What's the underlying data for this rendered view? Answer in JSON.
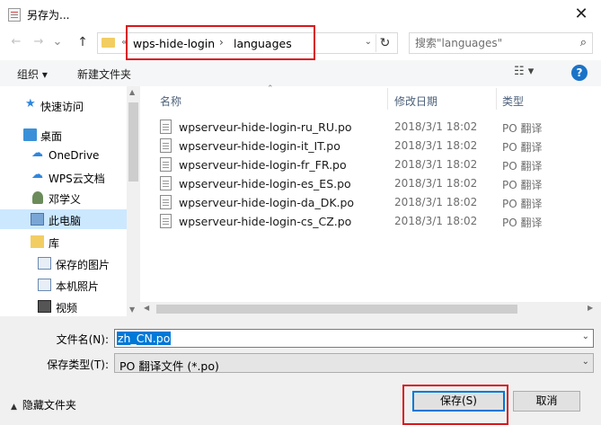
{
  "window": {
    "title": "另存为...",
    "close_glyph": "✕"
  },
  "nav": {
    "back_glyph": "←",
    "forward_glyph": "→",
    "history_glyph": "⌄",
    "up_glyph": "↑",
    "overflow_glyph": "«",
    "breadcrumb": [
      "wps-hide-login",
      "languages"
    ],
    "separator_glyph": "›",
    "dropdown_glyph": "⌄",
    "refresh_glyph": "↻",
    "search_placeholder": "搜索\"languages\"",
    "search_icon": "search-icon"
  },
  "toolbar": {
    "organize": "组织 ▾",
    "new_folder": "新建文件夹",
    "view_glyph": "☷ ▾",
    "help": "?"
  },
  "sidebar": {
    "items": [
      {
        "label": "快速访问",
        "icon": "star-icon",
        "glyph": "★"
      },
      {
        "label": "桌面",
        "icon": "desktop-icon",
        "glyph": ""
      },
      {
        "label": "OneDrive",
        "icon": "cloud-icon",
        "glyph": "☁"
      },
      {
        "label": "WPS云文档",
        "icon": "wps-cloud-icon",
        "glyph": "☁"
      },
      {
        "label": "邓学义",
        "icon": "user-icon",
        "glyph": ""
      },
      {
        "label": "此电脑",
        "icon": "computer-icon",
        "glyph": ""
      },
      {
        "label": "库",
        "icon": "library-icon",
        "glyph": ""
      },
      {
        "label": "保存的图片",
        "icon": "pictures-icon",
        "glyph": ""
      },
      {
        "label": "本机照片",
        "icon": "photos-icon",
        "glyph": ""
      },
      {
        "label": "视频",
        "icon": "video-icon",
        "glyph": ""
      }
    ],
    "selected": "此电脑"
  },
  "files": {
    "columns": [
      "名称",
      "修改日期",
      "类型"
    ],
    "sort_glyph": "⌃",
    "rows": [
      {
        "name": "wpserveur-hide-login-ru_RU.po",
        "date": "2018/3/1 18:02",
        "type": "PO 翻译"
      },
      {
        "name": "wpserveur-hide-login-it_IT.po",
        "date": "2018/3/1 18:02",
        "type": "PO 翻译"
      },
      {
        "name": "wpserveur-hide-login-fr_FR.po",
        "date": "2018/3/1 18:02",
        "type": "PO 翻译"
      },
      {
        "name": "wpserveur-hide-login-es_ES.po",
        "date": "2018/3/1 18:02",
        "type": "PO 翻译"
      },
      {
        "name": "wpserveur-hide-login-da_DK.po",
        "date": "2018/3/1 18:02",
        "type": "PO 翻译"
      },
      {
        "name": "wpserveur-hide-login-cs_CZ.po",
        "date": "2018/3/1 18:02",
        "type": "PO 翻译"
      }
    ]
  },
  "form": {
    "filename_label": "文件名(N):",
    "filename_value": "zh_CN.po",
    "filetype_label": "保存类型(T):",
    "filetype_value": "PO 翻译文件 (*.po)",
    "dropdown_glyph": "⌄"
  },
  "footer": {
    "hide_folders": "隐藏文件夹",
    "hide_caret": "▲",
    "save": "保存(S)",
    "cancel": "取消"
  },
  "colors": {
    "highlight_red": "#d9161c",
    "selection_blue": "#0078d7",
    "sidebar_selected": "#cce8ff",
    "help_blue": "#1a73c8"
  }
}
